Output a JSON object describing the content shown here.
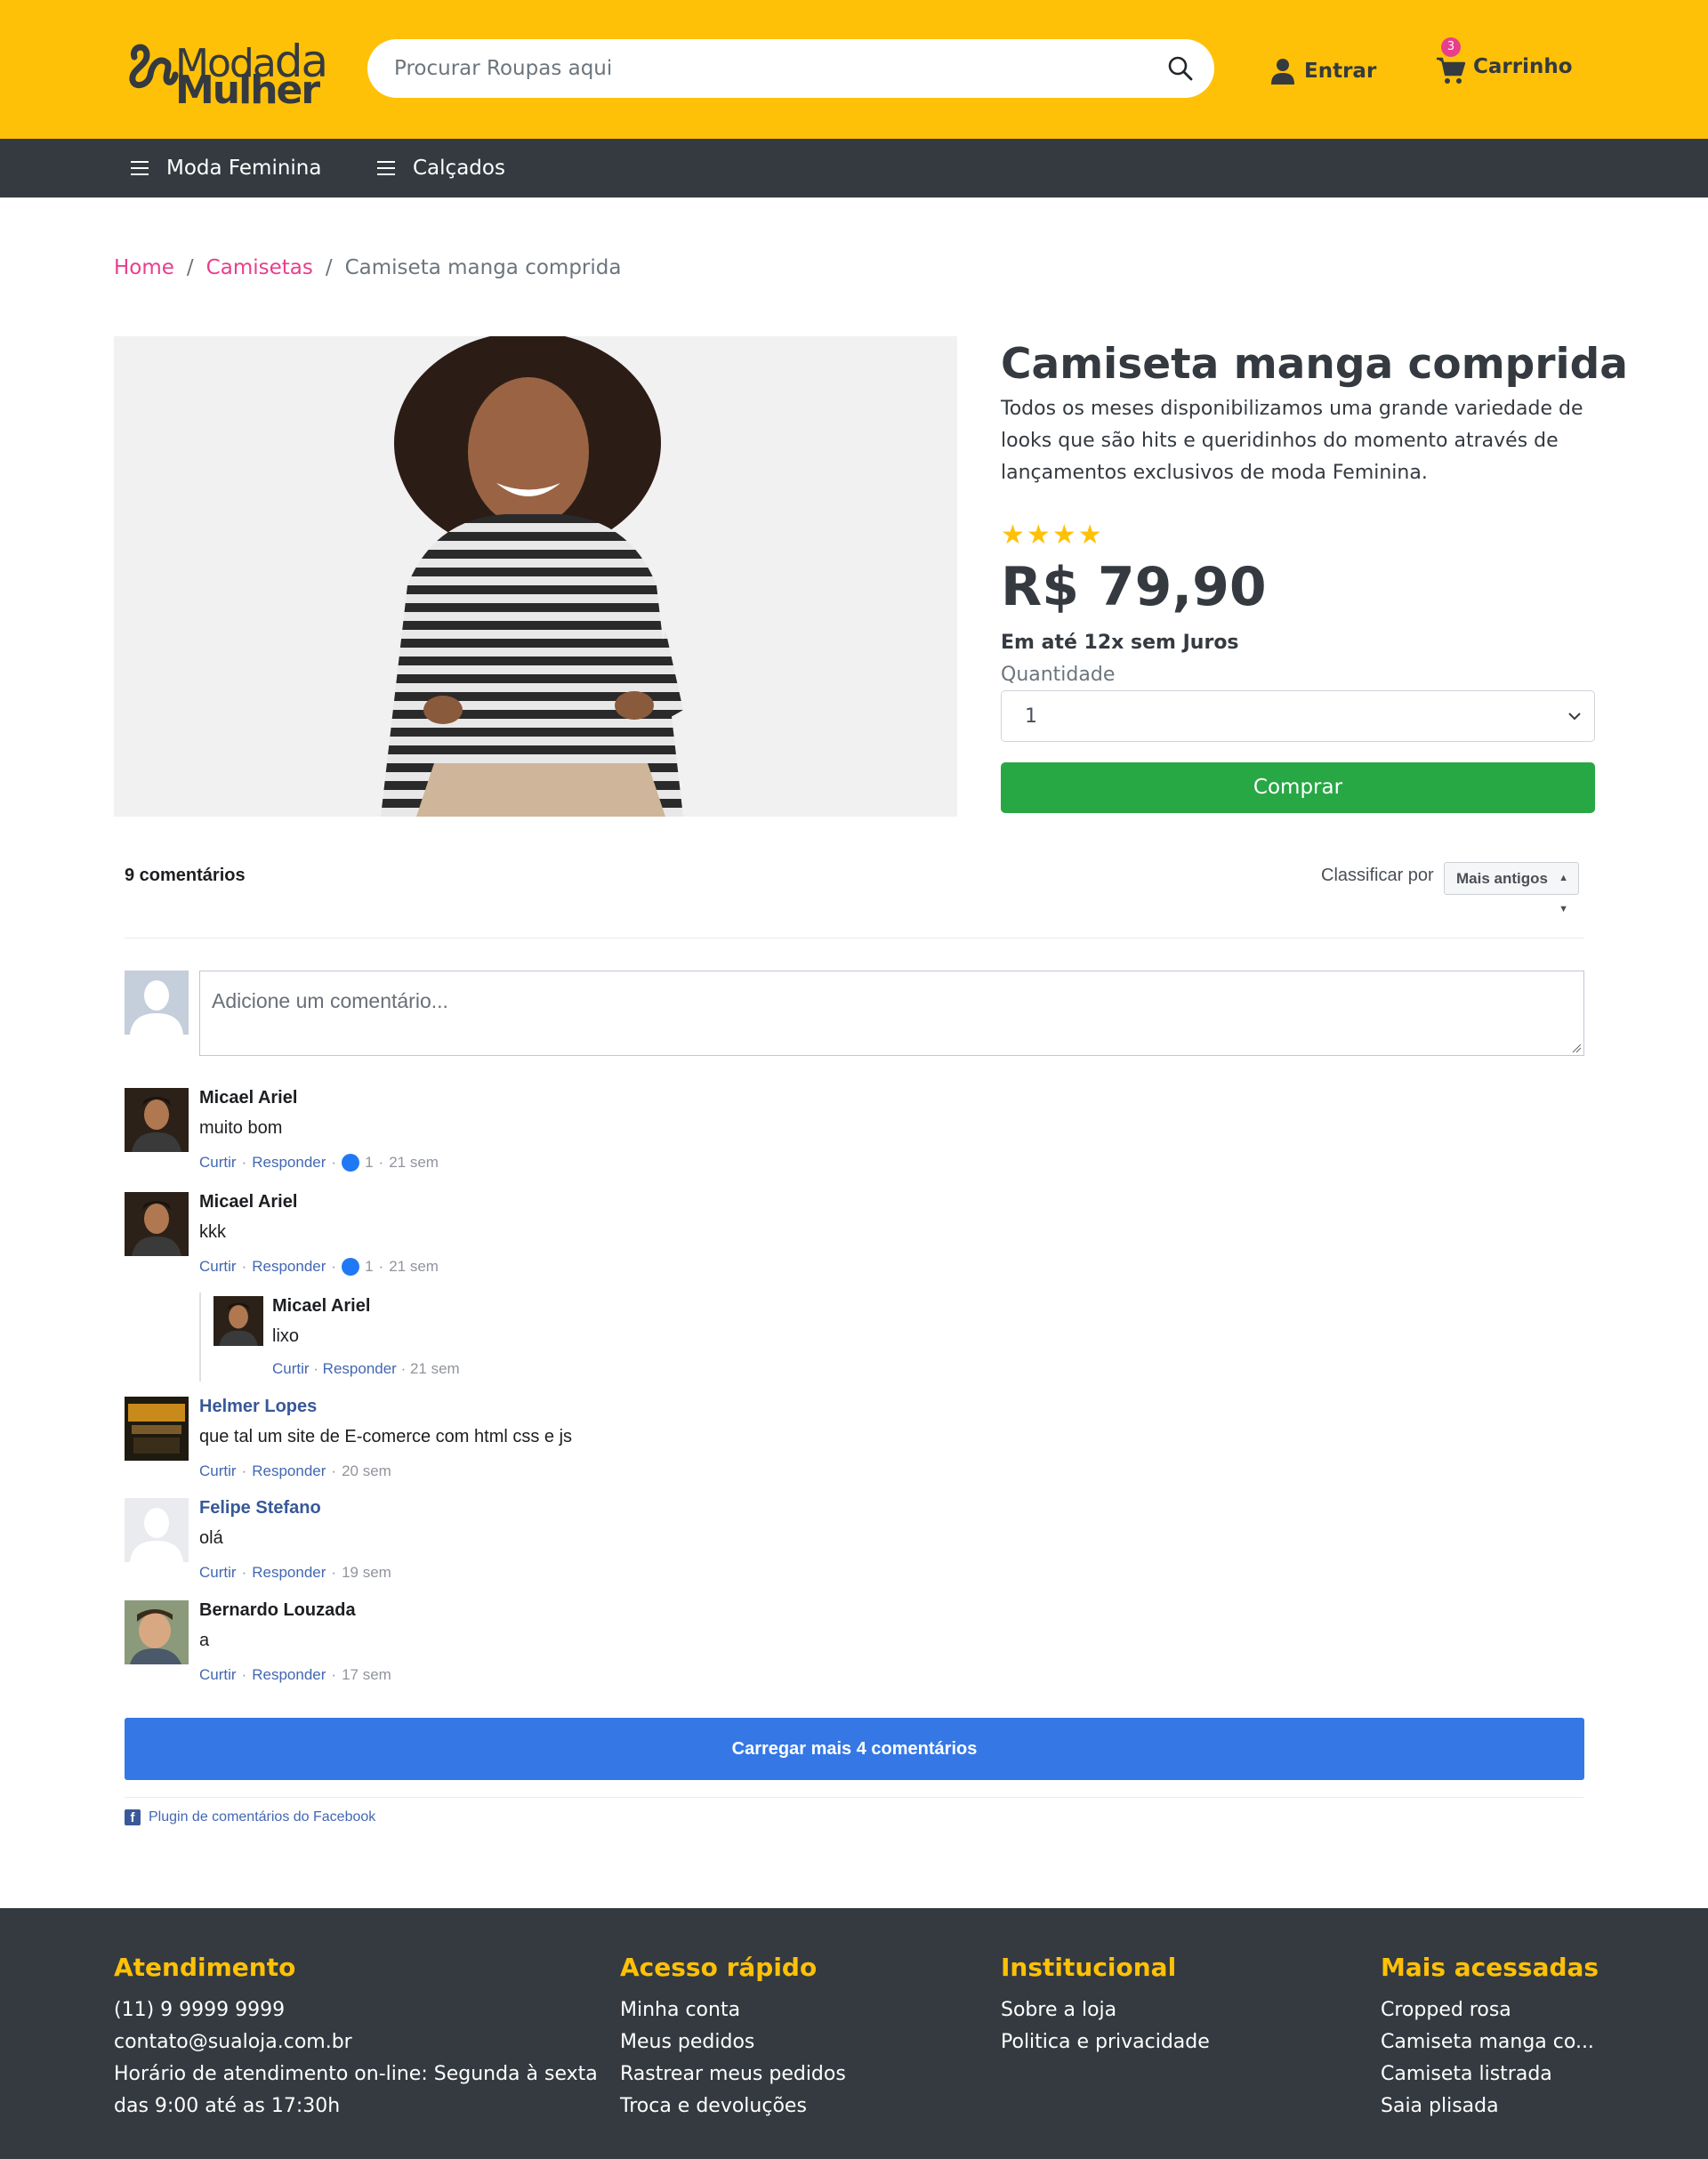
{
  "header": {
    "logo": {
      "line1": "Moda",
      "line1b": "da",
      "line2": "Mulher"
    },
    "search_placeholder": "Procurar Roupas aqui",
    "login_label": "Entrar",
    "cart_label": "Carrinho",
    "cart_count": "3",
    "icons": {
      "search": "search-icon",
      "user": "user-icon",
      "cart": "cart-icon"
    }
  },
  "nav": {
    "items": [
      {
        "label": "Moda Feminina"
      },
      {
        "label": "Calçados"
      }
    ]
  },
  "breadcrumb": {
    "home": "Home",
    "category": "Camisetas",
    "current": "Camiseta manga comprida",
    "separator": "/"
  },
  "product": {
    "title": "Camiseta manga comprida",
    "description": "Todos os meses disponibilizamos uma grande variedade de looks que são hits e queridinhos do momento através de lançamentos exclusivos de moda Feminina.",
    "rating": 4,
    "rating_stars": "★",
    "price": "R$ 79,90",
    "installments": "Em até 12x sem Juros",
    "quantity_label": "Quantidade",
    "quantity_value": "1",
    "buy_label": "Comprar"
  },
  "comments": {
    "count_label": "9 comentários",
    "sort_label": "Classificar por",
    "sort_value": "Mais antigos",
    "input_placeholder": "Adicione um comentário...",
    "items": [
      {
        "name": "Micael Ariel",
        "text": "muito bom",
        "like": "Curtir",
        "reply": "Responder",
        "likes": "1",
        "time": "21 sem"
      },
      {
        "name": "Micael Ariel",
        "text": "kkk",
        "like": "Curtir",
        "reply": "Responder",
        "likes": "1",
        "time": "21 sem"
      },
      {
        "name": "Helmer Lopes",
        "text": "que tal um site de E-comerce com html css e js",
        "like": "Curtir",
        "reply": "Responder",
        "time": "20 sem"
      },
      {
        "name": "Felipe Stefano",
        "text": "olá",
        "like": "Curtir",
        "reply": "Responder",
        "time": "19 sem"
      },
      {
        "name": "Bernardo Louzada",
        "text": "a",
        "like": "Curtir",
        "reply": "Responder",
        "time": "17 sem"
      }
    ],
    "reply": {
      "name": "Micael Ariel",
      "text": "lixo",
      "like": "Curtir",
      "reply": "Responder",
      "time": "21 sem"
    },
    "load_more": "Carregar mais 4 comentários",
    "plugin_label": "Plugin de comentários do Facebook"
  },
  "footer": {
    "columns": [
      {
        "title": "Atendimento",
        "lines": [
          "(11) 9 9999 9999",
          "contato@sualoja.com.br",
          "Horário de atendimento on-line: Segunda à sexta",
          "das 9:00 até as 17:30h"
        ]
      },
      {
        "title": "Acesso rápido",
        "lines": [
          "Minha conta",
          "Meus pedidos",
          "Rastrear meus pedidos",
          "Troca e devoluções"
        ]
      },
      {
        "title": "Institucional",
        "lines": [
          "Sobre a loja",
          "Politica e privacidade"
        ]
      },
      {
        "title": "Mais acessadas",
        "lines": [
          "Cropped rosa",
          "Camiseta manga co...",
          "Camiseta listrada",
          "Saia plisada"
        ]
      }
    ]
  },
  "colors": {
    "brand_yellow": "#ffc107",
    "dark": "#343a40",
    "link_pink": "#e83e8c",
    "buy_green": "#28a745",
    "fb_blue": "#3578e5"
  }
}
